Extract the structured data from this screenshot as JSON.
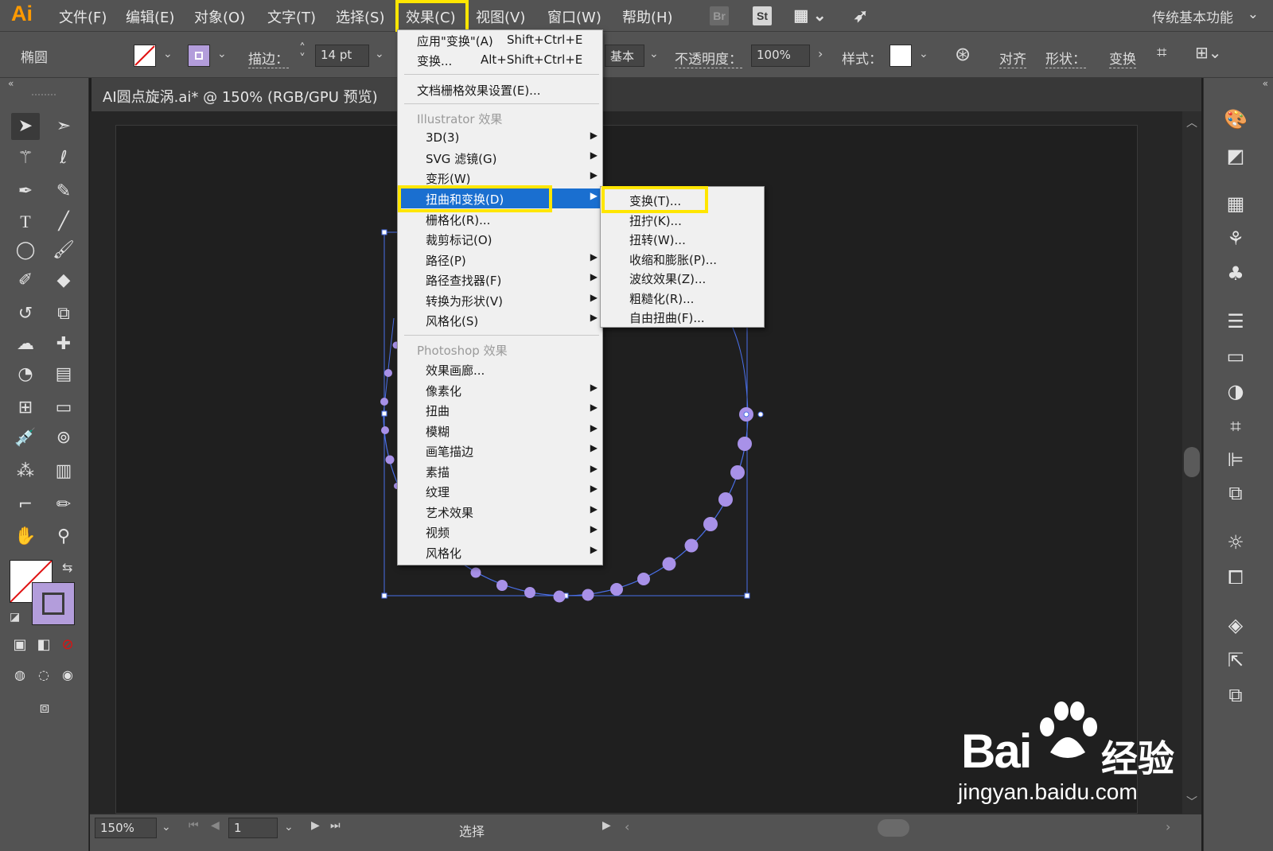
{
  "app": {
    "logo": "Ai",
    "workspace_label": "传统基本功能",
    "workspace_caret": "⌄"
  },
  "menubar": {
    "items": [
      "文件(F)",
      "编辑(E)",
      "对象(O)",
      "文字(T)",
      "选择(S)",
      "效果(C)",
      "视图(V)",
      "窗口(W)",
      "帮助(H)"
    ],
    "active": "效果(C)",
    "icons": [
      "Br",
      "St"
    ]
  },
  "control": {
    "object_label": "椭圆",
    "stroke_label": "描边：",
    "stroke_value": "14 pt",
    "profile_label": "基本",
    "opacity_label": "不透明度：",
    "opacity_value": "100%",
    "style_label": "样式：",
    "align_label": "对齐",
    "shape_label": "形状：",
    "transform_label": "变换",
    "fill_color": "#ffffff",
    "stroke_color": "#b39ddb"
  },
  "document": {
    "tab_title": "AI圆点旋涡.ai* @ 150% (RGB/GPU 预览)"
  },
  "effect_menu": {
    "apply_last": {
      "label": "应用\"变换\"(A)",
      "shortcut": "Shift+Ctrl+E"
    },
    "last_effect": {
      "label": "变换...",
      "shortcut": "Alt+Shift+Ctrl+E"
    },
    "raster_settings": "文档栅格效果设置(E)...",
    "illustrator_header": "Illustrator 效果",
    "illustrator_items": [
      "3D(3)",
      "SVG 滤镜(G)",
      "变形(W)",
      "扭曲和变换(D)",
      "栅格化(R)...",
      "裁剪标记(O)",
      "路径(P)",
      "路径查找器(F)",
      "转换为形状(V)",
      "风格化(S)"
    ],
    "photoshop_header": "Photoshop 效果",
    "photoshop_items": [
      "效果画廊...",
      "像素化",
      "扭曲",
      "模糊",
      "画笔描边",
      "素描",
      "纹理",
      "艺术效果",
      "视频",
      "风格化"
    ],
    "highlighted_item": "扭曲和变换(D)"
  },
  "distort_submenu": {
    "items": [
      "变换(T)...",
      "扭拧(K)...",
      "扭转(W)...",
      "收缩和膨胀(P)...",
      "波纹效果(Z)...",
      "粗糙化(R)...",
      "自由扭曲(F)..."
    ],
    "highlighted_item": "变换(T)..."
  },
  "status": {
    "zoom": "150%",
    "page": "1",
    "tool_label": "选择"
  },
  "colors": {
    "highlight_box": "#ffe600",
    "menu_selection": "#1a6fd0",
    "dot_fill": "#a891e8",
    "path_stroke": "#4a6fe8"
  },
  "watermark": {
    "brand": "Bai",
    "brand2": "经验",
    "url": "jingyan.baidu.com"
  }
}
